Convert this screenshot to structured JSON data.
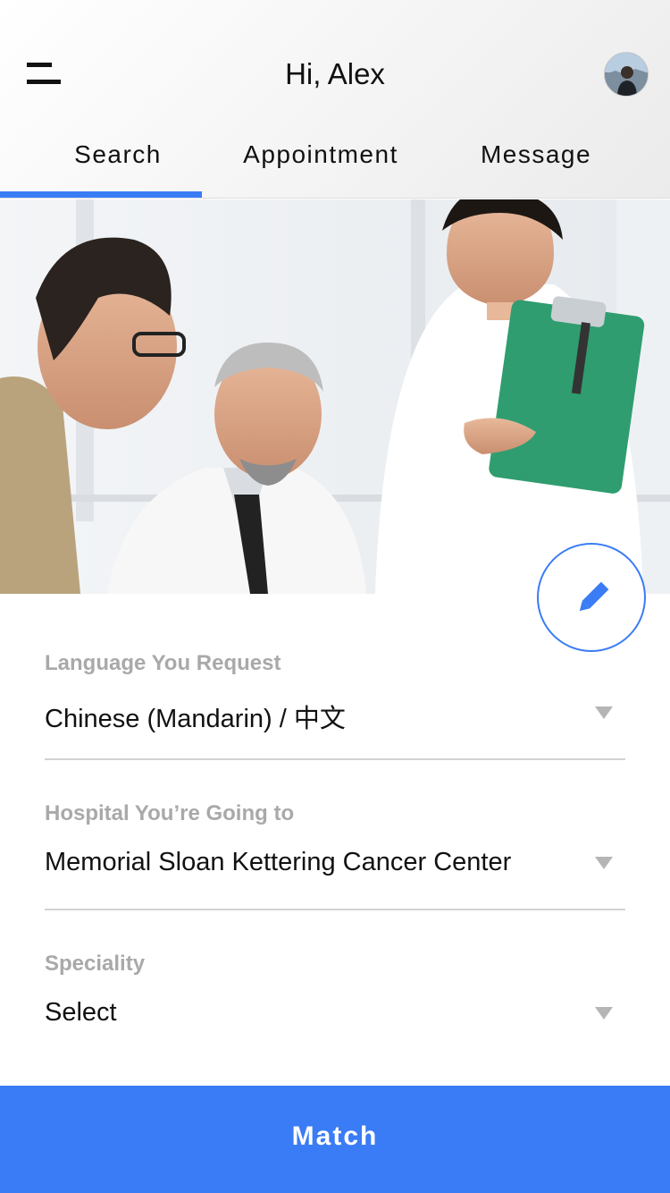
{
  "header": {
    "greeting": "Hi, Alex",
    "menu_icon": "hamburger-menu-icon",
    "avatar_icon": "user-avatar"
  },
  "tabs": [
    {
      "label": "Search",
      "active": true
    },
    {
      "label": "Appointment",
      "active": false
    },
    {
      "label": "Message",
      "active": false
    }
  ],
  "hero": {
    "image": "doctor-patient-nurse-photo",
    "edit_icon": "pencil-icon"
  },
  "form": {
    "language": {
      "label": "Language You Request",
      "value": "Chinese (Mandarin) / 中文"
    },
    "hospital": {
      "label": "Hospital You’re Going to",
      "value": "Memorial Sloan Kettering Cancer Center"
    },
    "speciality": {
      "label": "Speciality",
      "value": "Select"
    }
  },
  "match_button": {
    "label": "Match"
  },
  "colors": {
    "accent": "#3a7cf5",
    "label_gray": "#a9a9a9",
    "divider": "#d3d3d3"
  }
}
